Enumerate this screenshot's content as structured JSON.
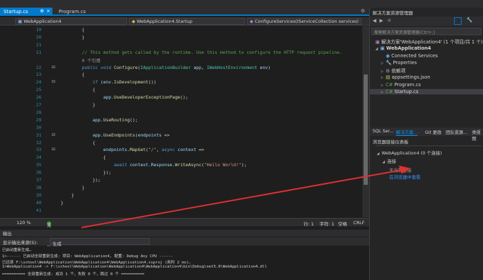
{
  "tabs": [
    {
      "label": "Startup.cs",
      "active": true
    },
    {
      "label": "Program.cs",
      "active": false
    }
  ],
  "nav": {
    "project": "WebApplication4",
    "class": "WebApplication4.Startup",
    "member": "ConfigureServices(IServiceCollection services)"
  },
  "code_lines": [
    {
      "num": "19",
      "text": "        {"
    },
    {
      "num": "20",
      "text": "        }"
    },
    {
      "num": "21",
      "text": ""
    },
    {
      "num": "21",
      "text": "        // This method gets called by the runtime. Use this method to configure the HTTP request pipeline."
    },
    {
      "num": "",
      "text": "        0 个引用"
    },
    {
      "num": "22",
      "text": "        public void Configure(IApplicationBuilder app, IWebHostEnvironment env)"
    },
    {
      "num": "23",
      "text": "        {"
    },
    {
      "num": "24",
      "text": "            if (env.IsDevelopment())"
    },
    {
      "num": "25",
      "text": "            {"
    },
    {
      "num": "26",
      "text": "                app.UseDeveloperExceptionPage();"
    },
    {
      "num": "27",
      "text": "            }"
    },
    {
      "num": "28",
      "text": ""
    },
    {
      "num": "29",
      "text": "            app.UseRouting();"
    },
    {
      "num": "30",
      "text": ""
    },
    {
      "num": "31",
      "text": "            app.UseEndpoints(endpoints =>"
    },
    {
      "num": "32",
      "text": "            {"
    },
    {
      "num": "33",
      "text": "                endpoints.MapGet(\"/\", async context =>"
    },
    {
      "num": "34",
      "text": "                {"
    },
    {
      "num": "35",
      "text": "                    await context.Response.WriteAsync(\"Hello World!\");"
    },
    {
      "num": "36",
      "text": "                });"
    },
    {
      "num": "37",
      "text": "            });"
    },
    {
      "num": "38",
      "text": "        }"
    },
    {
      "num": "39",
      "text": "    }"
    },
    {
      "num": "40",
      "text": "}"
    },
    {
      "num": "41",
      "text": ""
    }
  ],
  "status": {
    "zoom": "120 %",
    "issues": "未找到相关问题",
    "line": "行: 1",
    "char": "字符: 1",
    "spaces": "空格",
    "encoding": "CRLF"
  },
  "output": {
    "title": "输出",
    "source_label": "显示输出来源(S):",
    "source_value": "生成",
    "lines": [
      "已启动重新生成…",
      "1>------ 已启动全部重新生成: 项目: WebApplication4, 配置: Debug Any CPU ------",
      "已还原 F:\\school\\WebApplication\\WebApplication4\\WebApplication4.csproj (用时 2 ms)。",
      "1>WebApplication4 -> F:\\school\\WebApplication\\WebApplication4\\WebApplication4\\bin\\Debug\\net5.0\\WebApplication4.dll",
      "========== 全部重新生成: 成功 1 个，失败 0 个，跳过 0 个 =========="
    ]
  },
  "solution": {
    "title": "解决方案资源管理器",
    "search_placeholder": "搜索解决方案资源管理器(Ctrl+;)",
    "root": "解决方案'WebApplication4' (1 个项目/共 1 个)",
    "project": "WebApplication4",
    "items": [
      "Connected Services",
      "Properties",
      "依赖项",
      "appsettings.json",
      "Program.cs",
      "Startup.cs"
    ]
  },
  "right_tabs": [
    "SQL Ser...",
    "解决方案...",
    "Git 更改",
    "团队资源...",
    "类视图"
  ],
  "team": {
    "header": "浏览器链接仪表板",
    "project": "WebApplication4 (0 个连接)",
    "section": "连接",
    "no_connection": "无当前连接",
    "link": "在浏览器中查看"
  },
  "colors": {
    "accent": "#007acc",
    "keyword": "#569cd6",
    "comment": "#57a64a",
    "string": "#d69d85",
    "method": "#dcdcaa",
    "type": "#4ec9b0",
    "param": "#9cdcfe",
    "annotation_arrow": "#e03030"
  }
}
